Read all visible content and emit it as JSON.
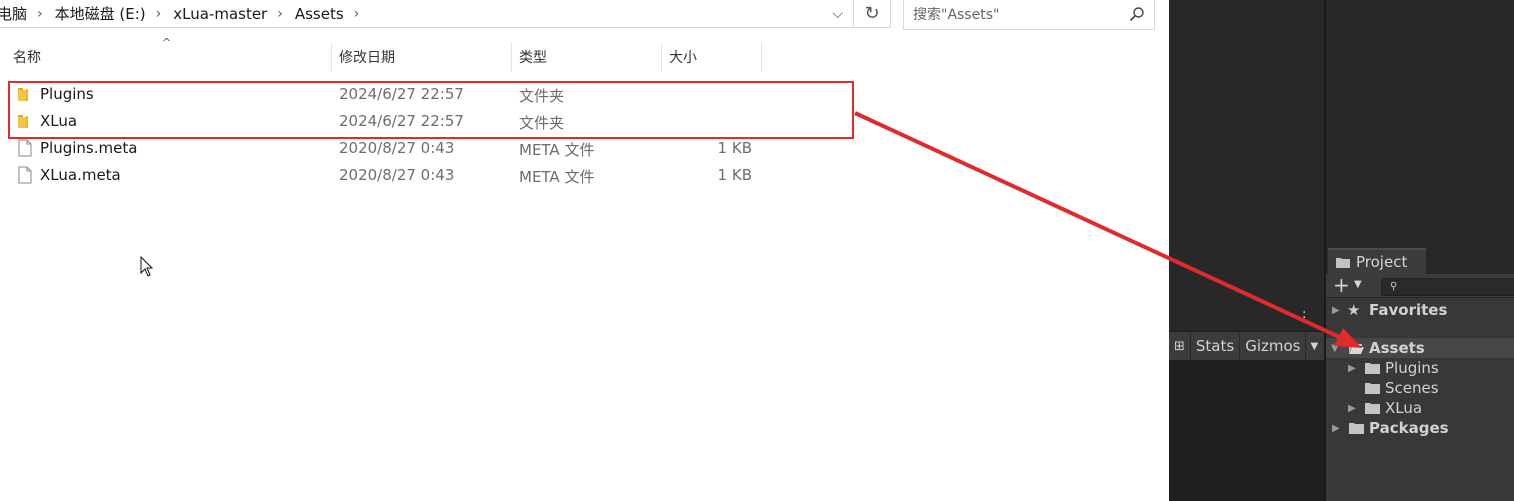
{
  "explorer": {
    "breadcrumb": [
      {
        "label": "电脑"
      },
      {
        "label": "本地磁盘 (E:)"
      },
      {
        "label": "xLua-master"
      },
      {
        "label": "Assets"
      }
    ],
    "search_placeholder": "搜索\"Assets\"",
    "columns": {
      "name": "名称",
      "modified": "修改日期",
      "type": "类型",
      "size": "大小"
    },
    "files": [
      {
        "name": "Plugins",
        "modified": "2024/6/27 22:57",
        "type": "文件夹",
        "size": "",
        "icon": "folder-icon"
      },
      {
        "name": "XLua",
        "modified": "2024/6/27 22:57",
        "type": "文件夹",
        "size": "",
        "icon": "folder-icon"
      },
      {
        "name": "Plugins.meta",
        "modified": "2020/8/27 0:43",
        "type": "META 文件",
        "size": "1 KB",
        "icon": "file-icon"
      },
      {
        "name": "XLua.meta",
        "modified": "2020/8/27 0:43",
        "type": "META 文件",
        "size": "1 KB",
        "icon": "file-icon"
      }
    ]
  },
  "unity": {
    "toolbar": {
      "stats": "Stats",
      "gizmos": "Gizmos"
    },
    "project_tab": "Project",
    "tree": {
      "favorites": "Favorites",
      "assets": "Assets",
      "children": [
        {
          "label": "Plugins",
          "expandable": true
        },
        {
          "label": "Scenes",
          "expandable": false
        },
        {
          "label": "XLua",
          "expandable": true
        }
      ],
      "packages": "Packages"
    }
  },
  "colors": {
    "annotation_red": "#e02b2b",
    "folder_yellow": "#f5c444",
    "unity_dark": "#282828"
  }
}
